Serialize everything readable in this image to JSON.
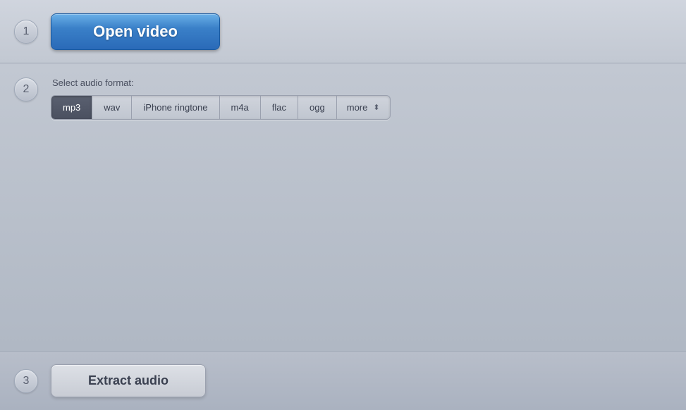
{
  "steps": {
    "step1": {
      "number": "1",
      "open_button_label": "Open video"
    },
    "step2": {
      "number": "2",
      "select_label": "Select audio format:",
      "formats": [
        {
          "id": "mp3",
          "label": "mp3",
          "active": true
        },
        {
          "id": "wav",
          "label": "wav",
          "active": false
        },
        {
          "id": "iphone-ringtone",
          "label": "iPhone ringtone",
          "active": false
        },
        {
          "id": "m4a",
          "label": "m4a",
          "active": false
        },
        {
          "id": "flac",
          "label": "flac",
          "active": false
        },
        {
          "id": "ogg",
          "label": "ogg",
          "active": false
        }
      ],
      "more_label": "more",
      "dropdown_arrow": "⬍"
    },
    "step3": {
      "number": "3",
      "extract_button_label": "Extract audio"
    }
  }
}
